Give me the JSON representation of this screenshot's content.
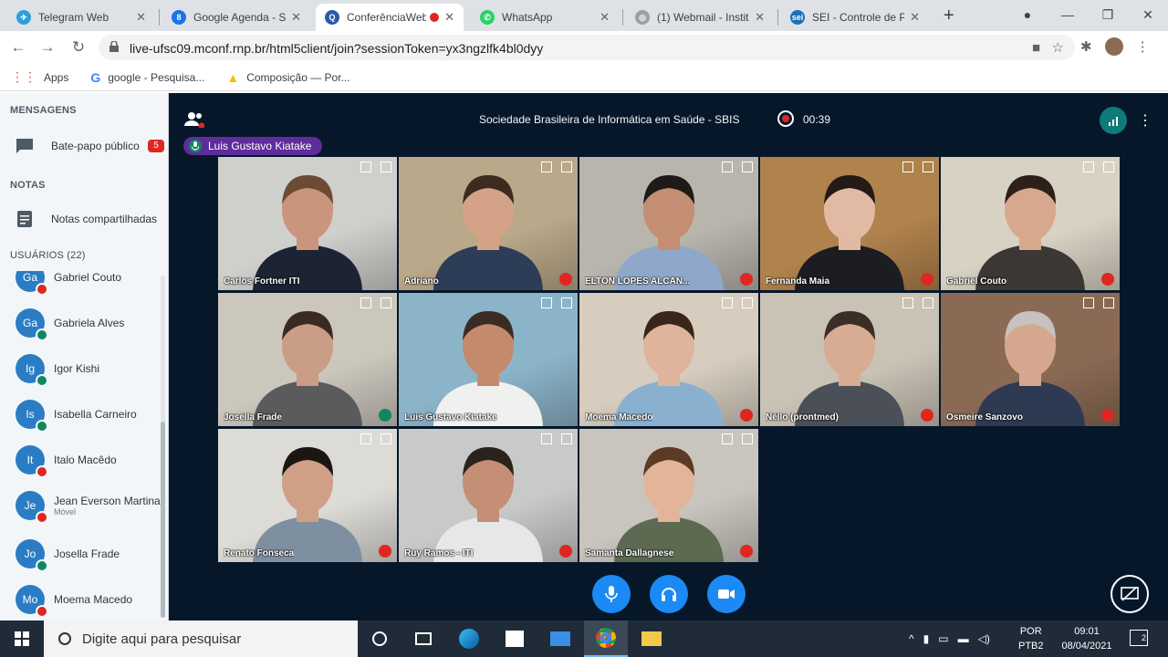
{
  "browser": {
    "tabs": [
      {
        "title": "Telegram Web",
        "color": "#2aa1da",
        "glyph": "✈"
      },
      {
        "title": "Google Agenda - Se",
        "color": "#1a73e8",
        "glyph": "8"
      },
      {
        "title": "ConferênciaWeb",
        "color": "#2b5aa8",
        "glyph": "Q"
      },
      {
        "title": "WhatsApp",
        "color": "#25d366",
        "glyph": "✆"
      },
      {
        "title": "(1) Webmail - Instit",
        "color": "#9aa0a6",
        "glyph": "◎"
      },
      {
        "title": "SEI - Controle de Pr",
        "color": "#1f6fb5",
        "glyph": "sei"
      }
    ],
    "url": "live-ufsc09.mconf.rnp.br/html5client/join?sessionToken=yx3ngzlfk4bl0dyy",
    "bookmarks": [
      {
        "label": "Apps",
        "icon": "apps-grid-icon"
      },
      {
        "label": "google - Pesquisa...",
        "icon": "google-icon"
      },
      {
        "label": "Composição — Por...",
        "icon": "drive-icon"
      }
    ]
  },
  "sidebar": {
    "messages_heading": "MENSAGENS",
    "public_chat_label": "Bate-papo público",
    "public_chat_unread": "5",
    "notes_heading": "NOTAS",
    "shared_notes_label": "Notas compartilhadas",
    "users_heading": "USUÁRIOS (22)",
    "users": [
      {
        "initials": "Ga",
        "name": "Gabriel Couto",
        "state": "muted",
        "sub": ""
      },
      {
        "initials": "Ga",
        "name": "Gabriela Alves",
        "state": "listen",
        "sub": ""
      },
      {
        "initials": "Ig",
        "name": "Igor Kishi",
        "state": "listen",
        "sub": ""
      },
      {
        "initials": "Is",
        "name": "Isabella Carneiro",
        "state": "listen",
        "sub": ""
      },
      {
        "initials": "It",
        "name": "Italo Macêdo",
        "state": "muted",
        "sub": ""
      },
      {
        "initials": "Je",
        "name": "Jean Everson Martina",
        "state": "muted",
        "sub": "Móvel"
      },
      {
        "initials": "Jo",
        "name": "Josella Frade",
        "state": "listen",
        "sub": ""
      },
      {
        "initials": "Mo",
        "name": "Moema Macedo",
        "state": "muted",
        "sub": ""
      }
    ]
  },
  "meeting": {
    "title": "Sociedade Brasileira de Informática em Saúde - SBIS",
    "recording_time": "00:39",
    "talker": "Luis Gustavo Kiatake",
    "colors": {
      "background": "#06172a",
      "accent": "#1b8af5",
      "talker": "#5e2d9b",
      "muted": "#df2721",
      "listen": "#0f8764"
    }
  },
  "videos": [
    {
      "name": "Carlos Fortner ITI",
      "state": "none",
      "bg": "#cfcfcc",
      "skin": "#c9957c",
      "shirt": "#1c2433",
      "hair": "#6b4b34"
    },
    {
      "name": "Adriano",
      "state": "muted",
      "bg": "#b9a889",
      "skin": "#d4a287",
      "shirt": "#2e3d57",
      "hair": "#3c2b1e"
    },
    {
      "name": "ELTON LOPES ALCAN...",
      "state": "muted",
      "bg": "#b8b5ad",
      "skin": "#c48e72",
      "shirt": "#8fa8c9",
      "hair": "#1f1a17"
    },
    {
      "name": "Fernanda Maia",
      "state": "muted",
      "bg": "#b0824c",
      "skin": "#e2b9a3",
      "shirt": "#1c1d22",
      "hair": "#241a16"
    },
    {
      "name": "Gabriel Couto",
      "state": "muted",
      "bg": "#d8d2c4",
      "skin": "#d8a88e",
      "shirt": "#3a3735",
      "hair": "#2c2019"
    },
    {
      "name": "Josella Frade",
      "state": "listen",
      "bg": "#ccc7bd",
      "skin": "#c99d86",
      "shirt": "#5b5a5d",
      "hair": "#3b2a22"
    },
    {
      "name": "Luis Gustavo Kiatake",
      "state": "none",
      "bg": "#8cb4c9",
      "skin": "#c48a6c",
      "shirt": "#f0f0ef",
      "hair": "#3a2c25",
      "speaking": true
    },
    {
      "name": "Moema Macedo",
      "state": "muted",
      "bg": "#d6cdbf",
      "skin": "#e0b49c",
      "shirt": "#8ab0cf",
      "hair": "#3a2619"
    },
    {
      "name": "Néllo (prontmed)",
      "state": "muted",
      "bg": "#c9c2b5",
      "skin": "#d8ac93",
      "shirt": "#4a4f58",
      "hair": "#3b2e26"
    },
    {
      "name": "Osmeire Sanzovo",
      "state": "muted",
      "bg": "#8b6a55",
      "skin": "#d6a78f",
      "shirt": "#2e3a52",
      "hair": "#c5c2bf"
    },
    {
      "name": "Renato Fonseca",
      "state": "muted",
      "bg": "#dcdbd6",
      "skin": "#cf9f86",
      "shirt": "#7e8fa0",
      "hair": "#1c1613"
    },
    {
      "name": "Ruy Ramos - ITI",
      "state": "muted",
      "bg": "#c8cac9",
      "skin": "#c48f74",
      "shirt": "#e6e7e9",
      "hair": "#2b221d"
    },
    {
      "name": "Samanta Dallagnese",
      "state": "muted",
      "bg": "#c9c5be",
      "skin": "#e2b59b",
      "shirt": "#5d6a52",
      "hair": "#5b3a26"
    }
  ],
  "taskbar": {
    "search_placeholder": "Digite aqui para pesquisar",
    "lang_top": "POR",
    "lang_bottom": "PTB2",
    "time": "09:01",
    "date": "08/04/2021",
    "notifications": "2"
  }
}
